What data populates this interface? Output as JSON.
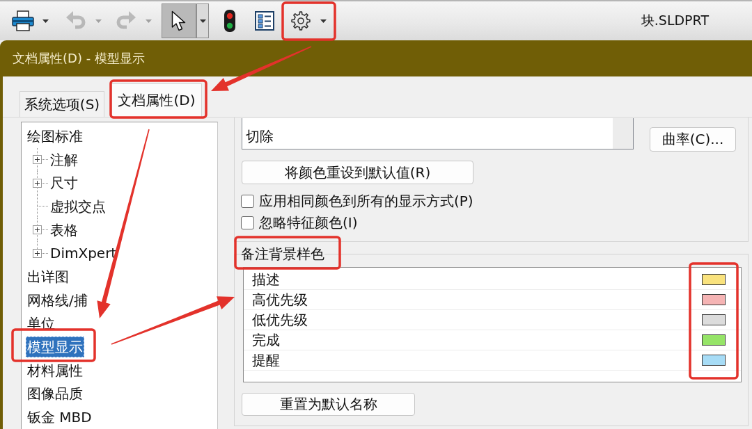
{
  "toolbar": {
    "buttons": [
      {
        "kind": "print",
        "disabled": false,
        "pressed": false,
        "dropdown": true
      },
      {
        "kind": "undo",
        "disabled": true,
        "pressed": false,
        "dropdown": true
      },
      {
        "kind": "redo",
        "disabled": true,
        "pressed": false,
        "dropdown": true
      },
      {
        "kind": "select",
        "disabled": false,
        "pressed": true,
        "dropdown": true
      },
      {
        "kind": "rebuild",
        "disabled": false,
        "pressed": false,
        "dropdown": false
      },
      {
        "kind": "properties",
        "disabled": false,
        "pressed": false,
        "dropdown": false
      },
      {
        "kind": "options",
        "disabled": false,
        "pressed": false,
        "dropdown": true
      }
    ],
    "document_title": "块.SLDPRT"
  },
  "dialog": {
    "title": "文档属性(D) - 模型显示",
    "tabs": [
      {
        "label": "系统选项(S)",
        "selected": false
      },
      {
        "label": "文档属性(D)",
        "selected": true
      }
    ],
    "tree": [
      {
        "label": "绘图标准",
        "selected": false,
        "children": [
          {
            "label": "注解",
            "selected": false,
            "expandable": true
          },
          {
            "label": "尺寸",
            "selected": false,
            "expandable": true
          },
          {
            "label": "虚拟交点",
            "selected": false,
            "expandable": false
          },
          {
            "label": "表格",
            "selected": false,
            "expandable": true
          },
          {
            "label": "DimXpert",
            "selected": false,
            "expandable": true
          }
        ]
      },
      {
        "label": "出详图",
        "selected": false
      },
      {
        "label": "网格线/捕",
        "selected": false
      },
      {
        "label": "单位",
        "selected": false
      },
      {
        "label": "模型显示",
        "selected": true
      },
      {
        "label": "材料属性",
        "selected": false
      },
      {
        "label": "图像品质",
        "selected": false
      },
      {
        "label": "钣金 MBD",
        "selected": false
      }
    ],
    "panel": {
      "color_list": {
        "items": [
          "切除"
        ]
      },
      "curvature_button": "曲率(C)...",
      "reset_colors_button": "将颜色重设到默认值(R)",
      "checkboxes": [
        {
          "label": "应用相同颜色到所有的显示方式(P)",
          "checked": false
        },
        {
          "label": "忽略特征颜色(I)",
          "checked": false
        }
      ],
      "note_styles": {
        "title": "备注背景样色",
        "rows": [
          {
            "label": "描述",
            "color": "#f9e27d"
          },
          {
            "label": "高优先级",
            "color": "#f5b4b4"
          },
          {
            "label": "低优先级",
            "color": "#dcdcdc"
          },
          {
            "label": "完成",
            "color": "#96e468"
          },
          {
            "label": "提醒",
            "color": "#a7dcf6"
          }
        ],
        "reset_button": "重置为默认名称"
      }
    }
  }
}
